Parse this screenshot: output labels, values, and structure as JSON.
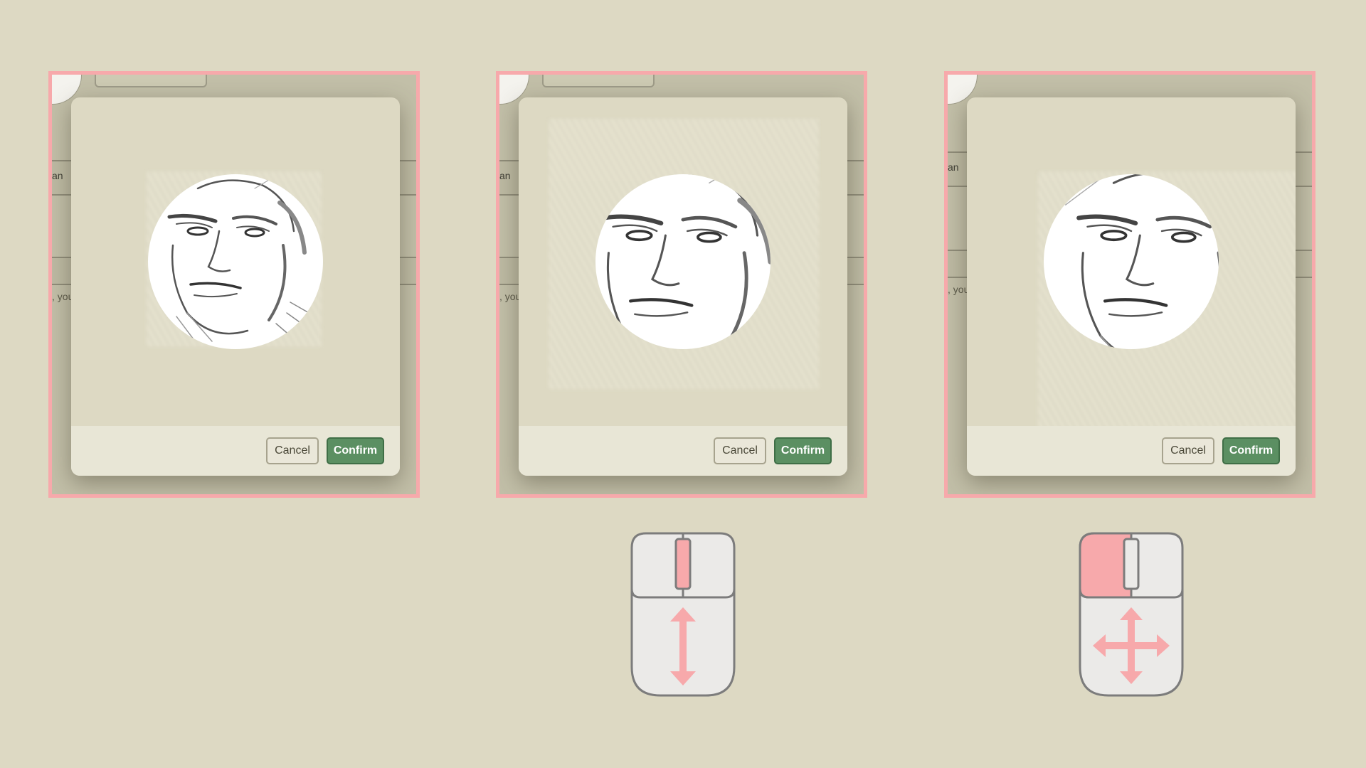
{
  "panels": [
    {
      "id": "step-1",
      "background": {
        "field_label": "an",
        "hint_text": ", you"
      },
      "dialog": {
        "cancel_label": "Cancel",
        "confirm_label": "Confirm",
        "state": "default crop"
      }
    },
    {
      "id": "step-2",
      "background": {
        "field_label": "an",
        "hint_text": ", you"
      },
      "dialog": {
        "cancel_label": "Cancel",
        "confirm_label": "Confirm",
        "state": "zoomed in"
      }
    },
    {
      "id": "step-3",
      "background": {
        "field_label": "an",
        "hint_text": ", you"
      },
      "dialog": {
        "cancel_label": "Cancel",
        "confirm_label": "Confirm",
        "state": "panned"
      }
    }
  ],
  "mouse_hints": [
    {
      "panel": "step-2",
      "action": "scroll-wheel",
      "icon": "vertical-arrows-icon"
    },
    {
      "panel": "step-3",
      "action": "left-click-drag",
      "icon": "move-arrows-icon"
    }
  ],
  "colors": {
    "background": "#ddd9c3",
    "highlight": "#f7a9ab",
    "confirm": "#5b8f62",
    "mouse_accent": "#f7a9ab"
  }
}
